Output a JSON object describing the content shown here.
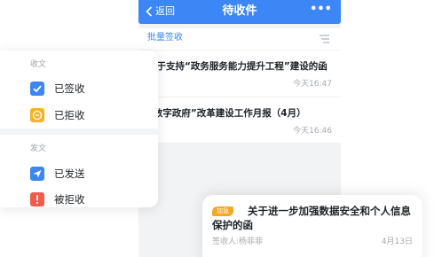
{
  "header": {
    "back_label": "返回",
    "title": "待收件",
    "more_label": "•••"
  },
  "toolbar": {
    "batch_label": "批量签收",
    "filter_icon": "filter-icon"
  },
  "documents": [
    {
      "title": "关于支持“政务服务能力提升工程”建设的函",
      "sender": "无",
      "time": "今天16:47"
    },
    {
      "title": "“数字政府”改革建设工作月报（4月）",
      "sender": "无",
      "time": "今天16:46"
    }
  ],
  "side_menu": {
    "received_section": "收文",
    "received_items": [
      {
        "label": "已签收",
        "icon": "check-icon",
        "color": "#3c86f5"
      },
      {
        "label": "已拒收",
        "icon": "minus-icon",
        "color": "#f5b324"
      }
    ],
    "sent_section": "发文",
    "sent_items": [
      {
        "label": "已发送",
        "icon": "send-icon",
        "color": "#3c86f5"
      },
      {
        "label": "被拒收",
        "icon": "alert-icon",
        "color": "#f25a4a"
      }
    ]
  },
  "featured": {
    "badge": "加急",
    "title": "关于进一步加强数据安全和个人信息保护的函",
    "recipient": "签收人:杨菲菲",
    "date": "4月13日"
  },
  "colors": {
    "primary": "#3c86f5",
    "urgent": "#f5a623",
    "danger": "#f25a4a",
    "muted": "#a8abb0"
  }
}
